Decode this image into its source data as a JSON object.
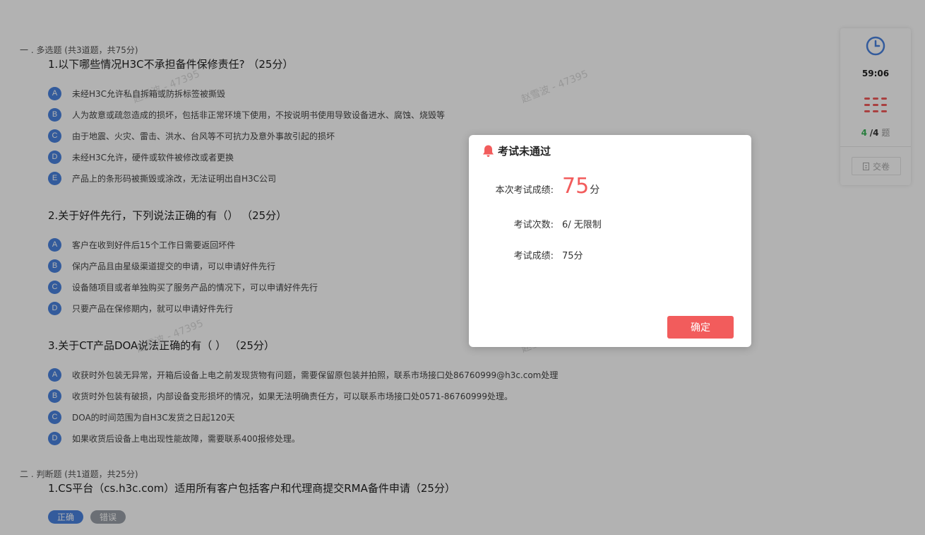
{
  "section1": {
    "title": "一 . 多选题 (共3道题，共75分)",
    "questions": [
      {
        "title": "1.以下哪些情况H3C不承担备件保修责任? （25分）",
        "options": [
          {
            "letter": "A",
            "text": "未经H3C允许私自拆箱或防拆标签被撕毁"
          },
          {
            "letter": "B",
            "text": "人为故意或疏忽造成的损坏，包括非正常环境下使用，不按说明书使用导致设备进水、腐蚀、烧毁等"
          },
          {
            "letter": "C",
            "text": "由于地震、火灾、雷击、洪水、台风等不可抗力及意外事故引起的损坏"
          },
          {
            "letter": "D",
            "text": "未经H3C允许，硬件或软件被修改或者更换"
          },
          {
            "letter": "E",
            "text": "产品上的条形码被撕毁或涂改，无法证明出自H3C公司"
          }
        ]
      },
      {
        "title": "2.关于好件先行，下列说法正确的有（） （25分）",
        "options": [
          {
            "letter": "A",
            "text": "客户在收到好件后15个工作日需要返回坏件"
          },
          {
            "letter": "B",
            "text": "保内产品且由星级渠道提交的申请，可以申请好件先行"
          },
          {
            "letter": "C",
            "text": "设备随项目或者单独购买了服务产品的情况下，可以申请好件先行"
          },
          {
            "letter": "D",
            "text": "只要产品在保修期内，就可以申请好件先行"
          }
        ]
      },
      {
        "title": "3.关于CT产品DOA说法正确的有（ ） （25分）",
        "options": [
          {
            "letter": "A",
            "text": "收获时外包装无异常，开箱后设备上电之前发现货物有问题，需要保留原包装并拍照，联系市场接口处86760999@h3c.com处理"
          },
          {
            "letter": "B",
            "text": "收货时外包装有破损，内部设备变形损坏的情况，如果无法明确责任方，可以联系市场接口处0571-86760999处理。"
          },
          {
            "letter": "C",
            "text": "DOA的时间范围为自H3C发货之日起120天"
          },
          {
            "letter": "D",
            "text": "如果收货后设备上电出现性能故障，需要联系400报修处理。"
          }
        ]
      }
    ]
  },
  "section2": {
    "title": "二 . 判断题 (共1道题，共25分)",
    "question": "1.CS平台（cs.h3c.com）适用所有客户包括客户和代理商提交RMA备件申请（25分）",
    "true_label": "正确",
    "false_label": "错误"
  },
  "sidebar": {
    "timer": "59:06",
    "answered": "4",
    "total": "/4",
    "unit": "题",
    "submit_label": "交卷"
  },
  "watermark": "赵雪波 - 47395",
  "dialog": {
    "title": "考试未通过",
    "current_score_label": "本次考试成绩:",
    "current_score_value": "75",
    "current_score_unit": "分",
    "attempts_label": "考试次数:",
    "attempts_value": "6/ 无限制",
    "score_label": "考试成绩:",
    "score_value": "75分",
    "confirm_label": "确定"
  },
  "colors": {
    "accent_blue": "#4a83e0",
    "alert_red": "#f25c5c",
    "success_green": "#3bb55a"
  }
}
